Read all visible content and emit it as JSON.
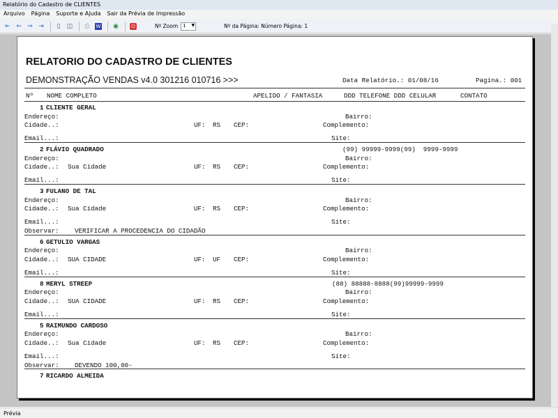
{
  "window": {
    "title": "Relatório do Cadastro de CLIENTES"
  },
  "menu": [
    "Arquivo",
    "Página",
    "Suporte e Ajuda",
    "Sair da Prévia de Impressão"
  ],
  "toolbar": {
    "zoom_label": "Nº Zoom",
    "zoom_value": "1",
    "page_label": "Nº da Página: Número Página: 1"
  },
  "report": {
    "title": "RELATORIO DO CADASTRO DE CLIENTES",
    "subtitle": "DEMONSTRAÇÃO VENDAS v4.0 301216 010716 >>>",
    "date": "Data Relatório.: 01/08/16",
    "page": "Pagina.: 001",
    "columns": {
      "num": "Nº",
      "name": "NOME COMPLETO",
      "alias": "APELIDO / FANTASIA",
      "phones": "DDD TELEFONE DDD CELULAR",
      "contact": "CONTATO"
    },
    "labels": {
      "address": "Endereço:",
      "city": "Cidade..:",
      "uf": "UF:",
      "cep": "CEP:",
      "district": "Bairro:",
      "complement": "Complemento:",
      "email": "Email...:",
      "site": "Site:",
      "notes": "Observar:"
    },
    "records": [
      {
        "num": "1",
        "name": "CLIENTE GERAL",
        "phones": "",
        "city": "",
        "uf": "RS",
        "notes": ""
      },
      {
        "num": "2",
        "name": "FLÁVIO QUADRADO",
        "phones": "(99) 99999-9999(99)  9999-9999",
        "city": "Sua Cidade",
        "uf": "RS",
        "notes": ""
      },
      {
        "num": "3",
        "name": "FULANO DE TAL",
        "phones": "",
        "city": "Sua Cidade",
        "uf": "RS",
        "notes": "VERIFICAR A PROCEDENCIA DO CIDADÃO"
      },
      {
        "num": "6",
        "name": "GETULIO VARGAS",
        "phones": "",
        "city": "SUA CIDADE",
        "uf": "UF",
        "notes": ""
      },
      {
        "num": "8",
        "name": "MERYL STREEP",
        "phones": "(88) 88888-8888(99)99999-9999",
        "city": "SUA CIDADE",
        "uf": "RS",
        "notes": ""
      },
      {
        "num": "5",
        "name": "RAIMUNDO CARDOSO",
        "phones": "",
        "city": "Sua Cidade",
        "uf": "RS",
        "notes": "DEVENDO 100,00-"
      },
      {
        "num": "7",
        "name": "RICARDO ALMEIDA",
        "phones": "",
        "city": "",
        "uf": "",
        "notes": ""
      }
    ]
  },
  "status": "Prévia"
}
